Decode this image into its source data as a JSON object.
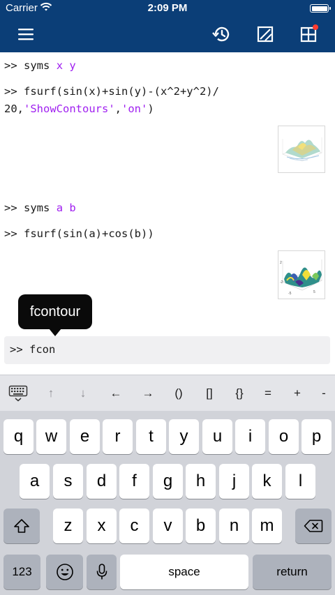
{
  "status_bar": {
    "carrier": "Carrier",
    "time": "2:09 PM"
  },
  "nav": {
    "icons": [
      "menu-icon",
      "history-icon",
      "figure-icon",
      "layout-icon"
    ],
    "badge_color": "#ff3b30",
    "bg_color": "#0b3e77"
  },
  "console": {
    "prompt": ">>",
    "cmd1": {
      "code": "syms ",
      "args": "x y"
    },
    "cmd2": {
      "line1": "fsurf(sin(x)+sin(y)-(x^2+y^2)/",
      "line2_code": "20,",
      "str1": "'ShowContours'",
      "comma": ",",
      "str2": "'on'",
      "close": ")"
    },
    "cmd3": {
      "code": "syms ",
      "args": "a b"
    },
    "cmd4": {
      "code": "fsurf(sin(a)+cos(b))"
    },
    "thumbs": [
      "surface-plot-thumbnail-1",
      "surface-plot-thumbnail-2"
    ]
  },
  "tooltip": {
    "text": "fcontour"
  },
  "input": {
    "value": ">> fcon"
  },
  "accessory": {
    "keys": [
      "↑",
      "↓",
      "←",
      "→",
      "()",
      "[]",
      "{}",
      "=",
      "+",
      "-"
    ]
  },
  "keyboard": {
    "row1": [
      "q",
      "w",
      "e",
      "r",
      "t",
      "y",
      "u",
      "i",
      "o",
      "p"
    ],
    "row2": [
      "a",
      "s",
      "d",
      "f",
      "g",
      "h",
      "j",
      "k",
      "l"
    ],
    "row3": [
      "z",
      "x",
      "c",
      "v",
      "b",
      "n",
      "m"
    ],
    "numbers_label": "123",
    "space_label": "space",
    "return_label": "return"
  }
}
